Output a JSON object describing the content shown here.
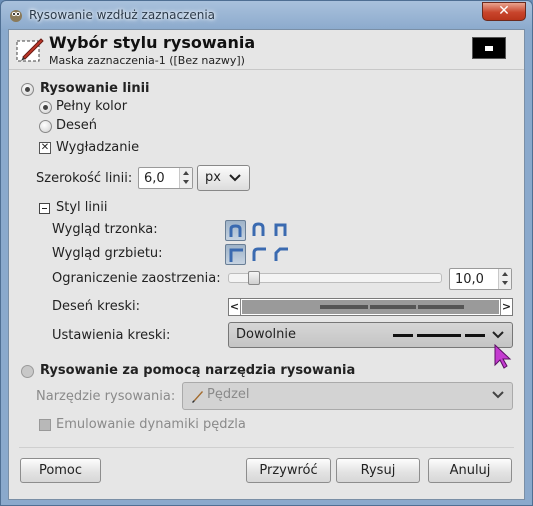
{
  "window": {
    "title": "Rysowanie wzdłuż zaznaczenia",
    "close_label": "✕"
  },
  "header": {
    "title": "Wybór stylu rysowania",
    "subtitle": "Maska zaznaczenia-1 ([Bez nazwy])"
  },
  "stroke_line": {
    "label": "Rysowanie linii",
    "solid_color_label": "Pełny kolor",
    "pattern_label": "Deseń",
    "antialiasing_label": "Wygładzanie",
    "antialiasing_checked": true,
    "line_width_label": "Szerokość linii:",
    "line_width_value": "6,0",
    "unit_value": "px"
  },
  "line_style": {
    "label": "Styl linii",
    "cap_style_label": "Wygląd trzonka:",
    "join_style_label": "Wygląd grzbietu:",
    "miter_limit_label": "Ograniczenie zaostrzenia:",
    "miter_limit_value": "10,0",
    "miter_limit_fraction": 0.1,
    "dash_pattern_label": "Deseń kreski:",
    "dash_pattern_left": "<",
    "dash_pattern_right": ">",
    "dash_preset_label": "Ustawienia kreski:",
    "dash_preset_value": "Dowolnie"
  },
  "stroke_paint": {
    "label": "Rysowanie za pomocą narzędzia rysowania",
    "tool_label": "Narzędzie rysowania:",
    "tool_value": "Pędzel",
    "emulate_label": "Emulowanie dynamiki pędzla",
    "emulate_checked": false
  },
  "buttons": {
    "help": "Pomoc",
    "reset": "Przywróć",
    "stroke": "Rysuj",
    "cancel": "Anuluj"
  }
}
